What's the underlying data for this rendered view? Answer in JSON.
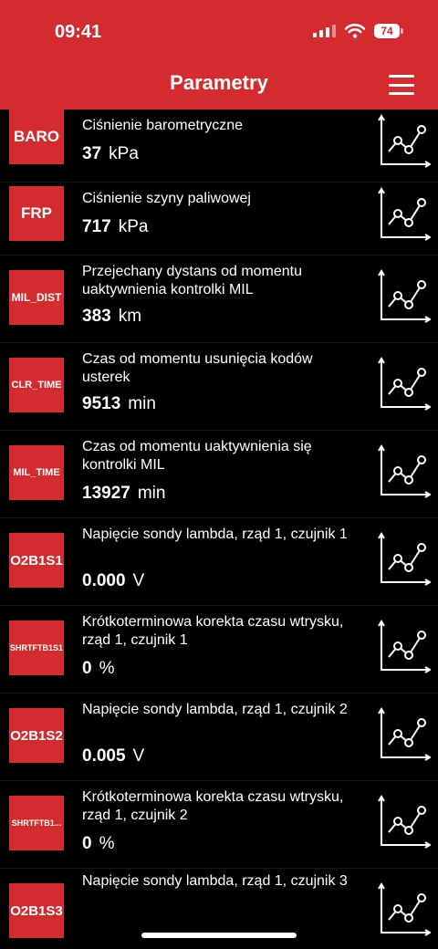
{
  "status": {
    "time": "09:41",
    "battery": "74"
  },
  "header": {
    "title": "Parametry"
  },
  "icons": {
    "menu": "hamburger-menu-icon",
    "graph": "line-chart-icon",
    "signal": "cellular-signal-icon",
    "wifi": "wifi-icon",
    "battery": "battery-icon"
  },
  "colors": {
    "accent": "#d42b2f",
    "background": "#000000"
  },
  "parameters": [
    {
      "code": "BARO",
      "name": "Ciśnienie barometryczne",
      "value": "37",
      "unit": "kPa"
    },
    {
      "code": "FRP",
      "name": "Ciśnienie szyny paliwowej",
      "value": "717",
      "unit": "kPa"
    },
    {
      "code": "MIL_DIST",
      "name": "Przejechany dystans od momentu uaktywnienia kontrolki MIL",
      "value": "383",
      "unit": "km"
    },
    {
      "code": "CLR_TIME",
      "name": "Czas od momentu usunięcia kodów usterek",
      "value": "9513",
      "unit": "min"
    },
    {
      "code": "MIL_TIME",
      "name": "Czas od momentu uaktywnienia się kontrolki MIL",
      "value": "13927",
      "unit": "min"
    },
    {
      "code": "O2B1S1",
      "name": "Napięcie sondy lambda, rząd 1, czujnik 1",
      "value": "0.000",
      "unit": "V"
    },
    {
      "code": "SHRTFTB1S1",
      "name": "Krótkoterminowa korekta czasu wtrysku, rząd 1, czujnik 1",
      "value": "0",
      "unit": "%"
    },
    {
      "code": "O2B1S2",
      "name": "Napięcie sondy lambda, rząd 1, czujnik 2",
      "value": "0.005",
      "unit": "V"
    },
    {
      "code": "SHRTFTB1...",
      "name": "Krótkoterminowa korekta czasu wtrysku, rząd 1, czujnik 2",
      "value": "0",
      "unit": "%"
    },
    {
      "code": "O2B1S3",
      "name": "Napięcie sondy lambda, rząd 1, czujnik 3",
      "value": "",
      "unit": ""
    }
  ]
}
